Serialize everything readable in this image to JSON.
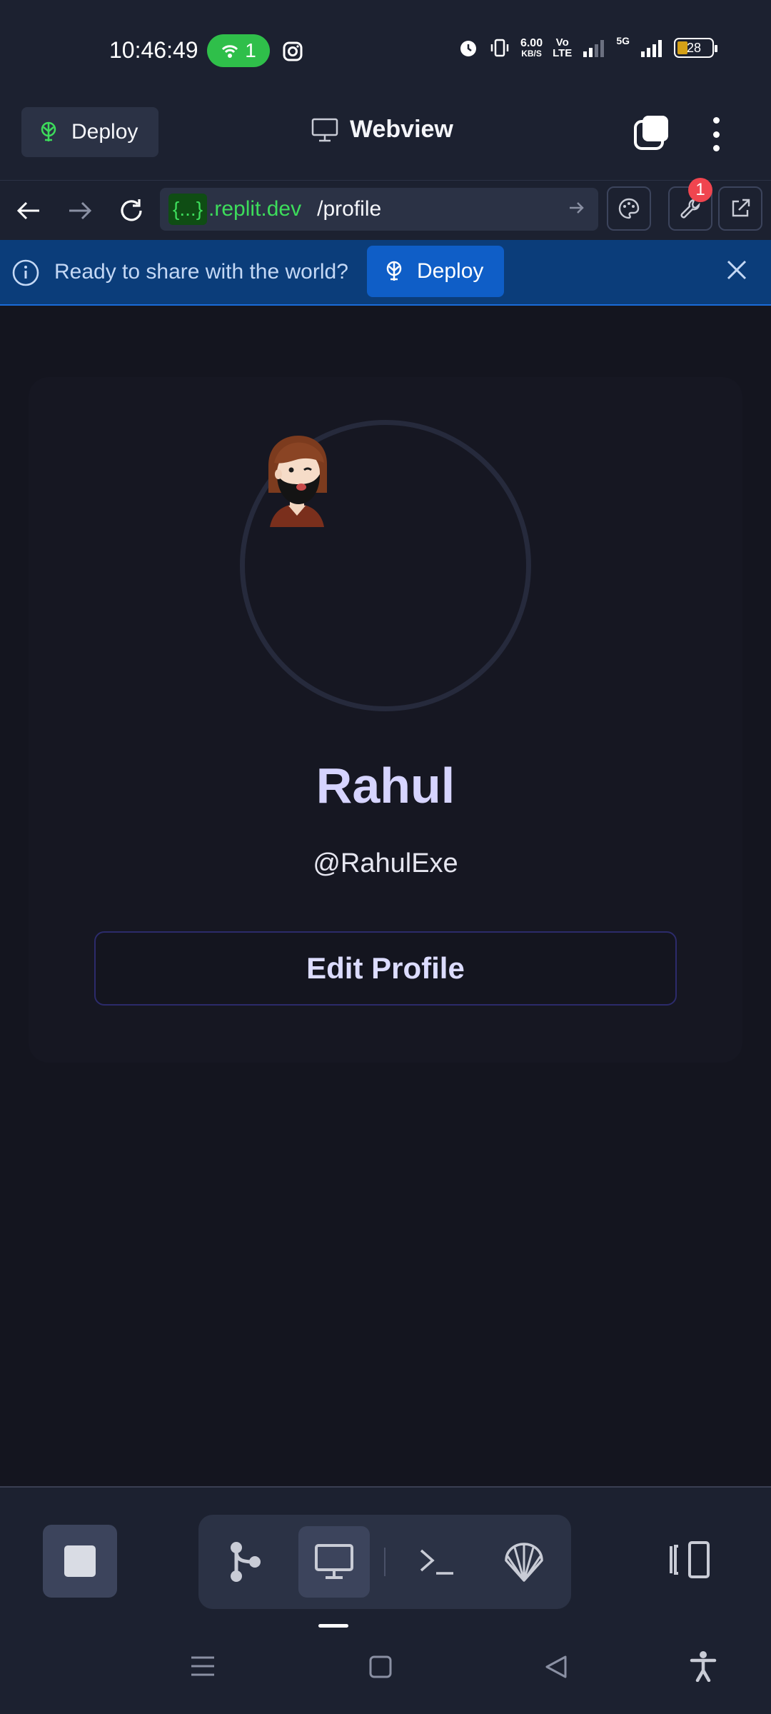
{
  "status_bar": {
    "time": "10:46:49",
    "hotspot_count": "1",
    "net_speed_value": "6.00",
    "net_speed_unit": "KB/S",
    "volte_top": "Vo",
    "volte_bottom": "LTE",
    "network_type": "5G",
    "battery": "28"
  },
  "header": {
    "deploy_label": "Deploy",
    "title": "Webview"
  },
  "url_bar": {
    "badge": "{...}",
    "host": ".replit.dev",
    "path": "/profile",
    "notification_count": "1"
  },
  "banner": {
    "message": "Ready to share with the world?",
    "deploy_label": "Deploy"
  },
  "profile": {
    "name": "Rahul",
    "handle": "@RahulExe",
    "edit_label": "Edit Profile"
  },
  "colors": {
    "chrome_bg": "#1c2130",
    "content_bg": "#14151f",
    "banner_bg": "#0b3d7a",
    "accent_blue": "#0f5ec7",
    "url_green": "#3ddc5b",
    "name_color": "#d6d4ff",
    "badge_red": "#f0454f"
  },
  "icons": {
    "header": [
      "deploy-icon",
      "monitor-icon",
      "tabs-icon",
      "more-icon"
    ],
    "nav": [
      "back-arrow-icon",
      "forward-arrow-icon",
      "refresh-icon",
      "go-arrow-icon",
      "palette-icon",
      "wrench-icon",
      "external-link-icon"
    ],
    "bottom": [
      "stop-icon",
      "git-icon",
      "monitor-icon",
      "terminal-icon",
      "shell-icon",
      "layout-toggle-icon"
    ],
    "android": [
      "menu-icon",
      "home-icon",
      "back-icon",
      "accessibility-icon"
    ]
  }
}
